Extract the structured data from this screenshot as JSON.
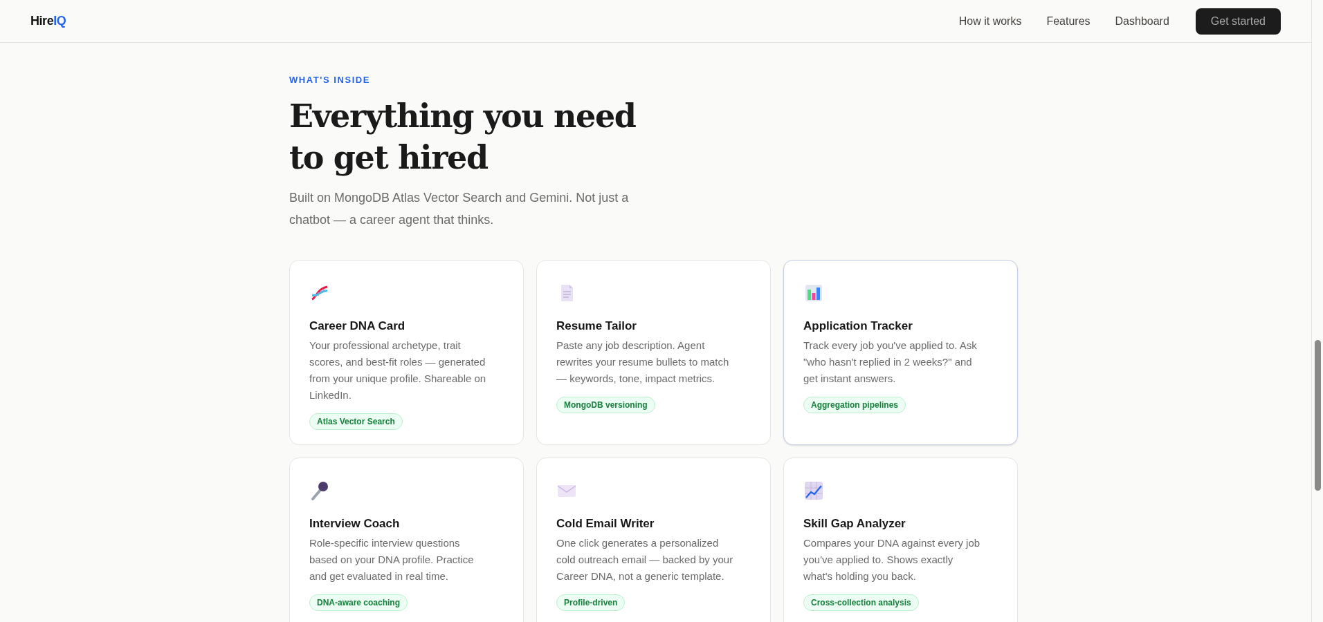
{
  "nav": {
    "logo": {
      "prefix": "Hire",
      "accent": "IQ"
    },
    "links": [
      "How it works",
      "Features",
      "Dashboard"
    ],
    "cta": "Get started"
  },
  "section": {
    "eyebrow": "WHAT'S INSIDE",
    "title_lines": [
      "Everything you need",
      "to get hired"
    ],
    "subtitle_lines": [
      "Built on MongoDB Atlas Vector Search and Gemini. Not just a",
      "chatbot — a career agent that thinks."
    ]
  },
  "features": [
    {
      "kind": "dna",
      "title": "Career DNA Card",
      "description": "Your professional archetype, trait scores, and best-fit roles — generated from your unique profile. Shareable on LinkedIn.",
      "tag": "Atlas Vector Search",
      "hovered": false
    },
    {
      "kind": "document",
      "title": "Resume Tailor",
      "description": "Paste any job description. Agent rewrites your resume bullets to match — keywords, tone, impact metrics.",
      "tag": "MongoDB versioning",
      "hovered": false
    },
    {
      "kind": "bar-chart",
      "title": "Application Tracker",
      "description": "Track every job you've applied to. Ask \"who hasn't replied in 2 weeks?\" and get instant answers.",
      "tag": "Aggregation pipelines",
      "hovered": true
    },
    {
      "kind": "microphone",
      "title": "Interview Coach",
      "description": "Role-specific interview questions based on your DNA profile. Practice and get evaluated in real time.",
      "tag": "DNA-aware coaching",
      "hovered": false
    },
    {
      "kind": "envelope",
      "title": "Cold Email Writer",
      "description": "One click generates a personalized cold outreach email — backed by your Career DNA, not a generic template.",
      "tag": "Profile-driven",
      "hovered": false
    },
    {
      "kind": "trend-chart",
      "title": "Skill Gap Analyzer",
      "description": "Compares your DNA against every job you've applied to. Shows exactly what's holding you back.",
      "tag": "Cross-collection analysis",
      "hovered": false
    }
  ]
}
